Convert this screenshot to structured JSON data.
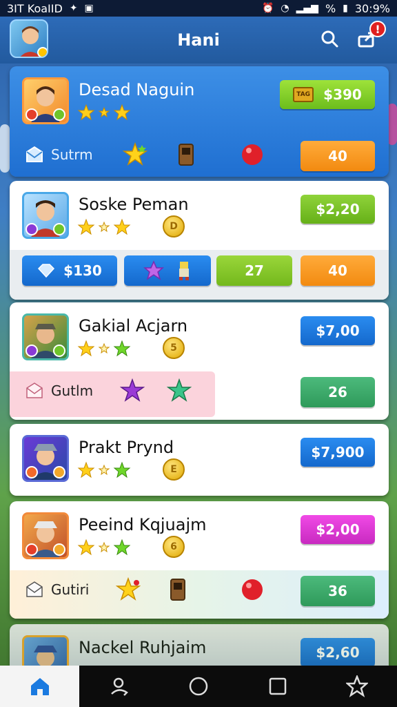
{
  "status_bar": {
    "carrier": "3IT KoaIID",
    "battery_text": "%",
    "time": "30:9%"
  },
  "header": {
    "title": "Hani",
    "notification_count": "!"
  },
  "cards": [
    {
      "name": "Desad Naguin",
      "price": "$390",
      "ticket_label": "TAG",
      "row_label": "Sutrm",
      "row_value": "40"
    },
    {
      "name": "Soske Peman",
      "price": "$2,20",
      "coin": "D",
      "pill_1": "$130",
      "pill_3": "27",
      "pill_4": "40"
    },
    {
      "name": "Gakial Acjarn",
      "price": "$7,00",
      "coin": "5",
      "row_label": "Gutlm",
      "row_value": "26"
    },
    {
      "name": "Prakt Prynd",
      "price": "$7,900",
      "coin": "E"
    },
    {
      "name": "Peeind Kqjuajm",
      "price": "$2,00",
      "coin": "6",
      "row_label": "Gutiri",
      "row_value": "36"
    },
    {
      "name": "Nackel Ruhjaim",
      "price": "$2,60"
    }
  ],
  "colors": {
    "green": "#7ec224",
    "blue": "#1a7ae0",
    "orange": "#f5921e",
    "magenta": "#e43ad6",
    "teal": "#3aa86a"
  },
  "icons": [
    "search-icon",
    "share-icon",
    "home-icon",
    "profile-icon",
    "circle-icon",
    "square-icon",
    "star-icon"
  ]
}
